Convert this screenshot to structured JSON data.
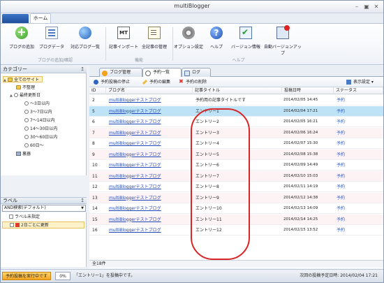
{
  "window": {
    "title": "multiBlogger",
    "min": "–",
    "restore": "▣",
    "close": "✕"
  },
  "ribbon_tabs": {
    "home": "ホーム"
  },
  "ribbon": {
    "buttons": [
      {
        "label": "ブログの追加"
      },
      {
        "label": "ブログデータ"
      },
      {
        "label": "対応ブログ一覧"
      },
      {
        "label": "記事インポート"
      },
      {
        "label": "全記事の管理"
      },
      {
        "label": "オプション設定"
      },
      {
        "label": "ヘルプ"
      },
      {
        "label": "バージョン情報"
      },
      {
        "label": "自動バージョンアップ"
      }
    ],
    "mt_icon_text": "MT",
    "help_icon_text": "?",
    "groups": {
      "blog": "ブログの追加/確認",
      "func": "機能",
      "help": "ヘルプ"
    }
  },
  "category_panel": {
    "title": "カテゴリー",
    "pin": "↥",
    "items": [
      {
        "label": "全てのサイト"
      },
      {
        "label": "不整理"
      },
      {
        "label": "最終更新日"
      },
      {
        "label": "～3日以内"
      },
      {
        "label": "3～7日以内"
      },
      {
        "label": "7～14日以内"
      },
      {
        "label": "14～30日以内"
      },
      {
        "label": "30～60日以内"
      },
      {
        "label": "60日～"
      },
      {
        "label": "裏器"
      }
    ]
  },
  "label_panel": {
    "title": "ラベル",
    "pin": "↥",
    "select_value": "AND検索(デフォルト)",
    "items": [
      {
        "label": "ラベル未指定"
      },
      {
        "label": "2日ごとに更新"
      }
    ]
  },
  "doc_tabs": [
    {
      "label": "ブログ管理"
    },
    {
      "label": "予約一覧"
    },
    {
      "label": "ログ"
    }
  ],
  "toolbar": {
    "stop": "予約投稿の停止",
    "edit": "予約の編集",
    "delete": "予約の削除",
    "display": "表示設定"
  },
  "table": {
    "headers": {
      "id": "ID",
      "blog": "ブログ名",
      "title": "記事タイトル",
      "date": "投稿日時",
      "status": "ステータス"
    },
    "rows": [
      {
        "id": "2",
        "blog": "multiBloggerテストブログ",
        "title": "予約用の記事タイトルです",
        "date": "2014/02/05 14:45",
        "status": "予約"
      },
      {
        "id": "5",
        "blog": "multiBloggerテストブログ",
        "title": "エントリー1",
        "date": "2014/02/04 17:21",
        "status": "予約"
      },
      {
        "id": "6",
        "blog": "multiBloggerテストブログ",
        "title": "エントリー2",
        "date": "2014/02/05 16:21",
        "status": "予約"
      },
      {
        "id": "7",
        "blog": "multiBloggerテストブログ",
        "title": "エントリー3",
        "date": "2014/02/06 16:24",
        "status": "予約"
      },
      {
        "id": "8",
        "blog": "multiBloggerテストブログ",
        "title": "エントリー4",
        "date": "2014/02/07 15:30",
        "status": "予約"
      },
      {
        "id": "9",
        "blog": "multiBloggerテストブログ",
        "title": "エントリー5",
        "date": "2014/02/08 15:38",
        "status": "予約"
      },
      {
        "id": "10",
        "blog": "multiBloggerテストブログ",
        "title": "エントリー6",
        "date": "2014/02/09 14:49",
        "status": "予約"
      },
      {
        "id": "11",
        "blog": "multiBloggerテストブログ",
        "title": "エントリー7",
        "date": "2014/02/10 15:03",
        "status": "予約"
      },
      {
        "id": "12",
        "blog": "multiBloggerテストブログ",
        "title": "エントリー8",
        "date": "2014/02/11 14:19",
        "status": "予約"
      },
      {
        "id": "13",
        "blog": "multiBloggerテストブログ",
        "title": "エントリー9",
        "date": "2014/02/12 14:38",
        "status": "予約"
      },
      {
        "id": "14",
        "blog": "multiBloggerテストブログ",
        "title": "エントリー10",
        "date": "2014/02/13 14:09",
        "status": "予約"
      },
      {
        "id": "15",
        "blog": "multiBloggerテストブログ",
        "title": "エントリー11",
        "date": "2014/02/14 14:25",
        "status": "予約"
      },
      {
        "id": "16",
        "blog": "multiBloggerテストブログ",
        "title": "エントリー12",
        "date": "2014/02/15 13:52",
        "status": "予約"
      }
    ],
    "total": "全18件"
  },
  "statusbar": {
    "badge": "予約投稿を実行中です",
    "progress": "0%",
    "message": "「エントリー1」を投稿中です。",
    "next": "次回の投稿予定日時: 2014/02/04 17:21"
  },
  "colors": {
    "selected_row": "#bfe3f6",
    "alt_row": "#fdf3f5",
    "link": "#2348b8",
    "highlight_oval": "#d92525"
  }
}
